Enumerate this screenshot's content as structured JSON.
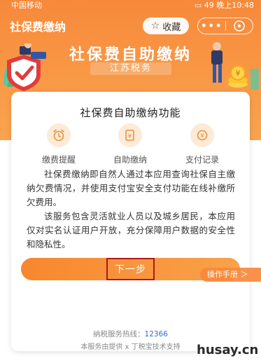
{
  "status_bar": {
    "carrier": "中国移动",
    "time_text": "晚上10:48",
    "battery": "49"
  },
  "header": {
    "title": "社保费缴纳",
    "favorite_label": "收藏"
  },
  "banner": {
    "title": "社保费自助缴纳",
    "subtitle": "江苏税务"
  },
  "card": {
    "title": "社保费自助缴纳功能",
    "features": [
      {
        "label": "缴费提醒",
        "icon": "alarm-clock-icon"
      },
      {
        "label": "自助缴纳",
        "icon": "document-pay-icon"
      },
      {
        "label": "支付记录",
        "icon": "yen-coin-icon"
      }
    ],
    "paragraph1": "社保费缴纳即自然人通过本应用查询社保自主缴纳欠费情况，并使用支付宝安全支付功能在线补缴所欠费用。",
    "paragraph2": "该服务包含灵活就业人员以及城乡居民，本应用仅对实名认证用户开放，充分保障用户数据的安全性和隐私性。",
    "next_button": "下一步",
    "hotline_label": "纳税服务热线：",
    "hotline_number": "12366",
    "support_text": "本服务由提供 x 丁税宝技术支持"
  },
  "manual_label": "操作手册 ＞",
  "watermark": "husay.cn",
  "colors": {
    "accent": "#f7893b",
    "highlight_border": "#b21818",
    "icon_bg": "#fdebd7"
  }
}
